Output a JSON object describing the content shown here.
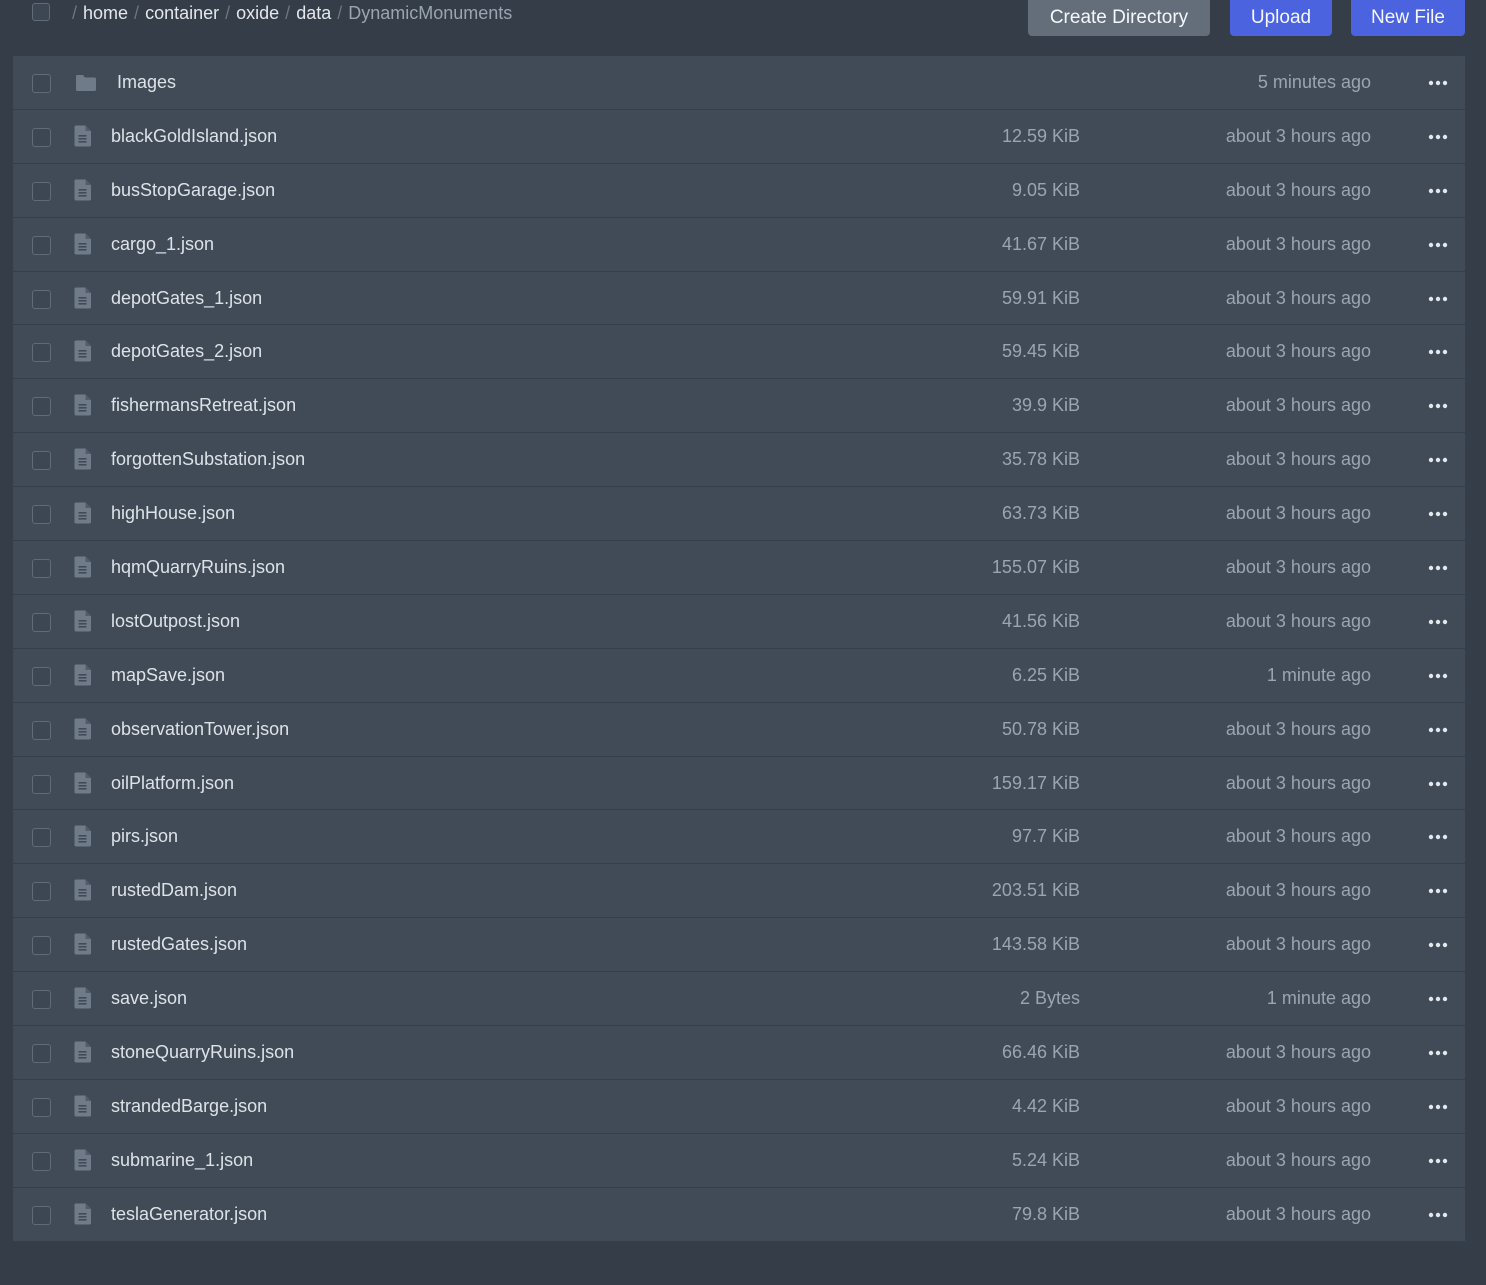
{
  "breadcrumb": {
    "separator": "/",
    "segments": [
      "home",
      "container",
      "oxide",
      "data",
      "DynamicMonuments"
    ]
  },
  "toolbar": {
    "create_directory_label": "Create Directory",
    "upload_label": "Upload",
    "new_file_label": "New File"
  },
  "colors": {
    "background": "#343d48",
    "row": "#414b57",
    "primary_button": "#4b63df",
    "secondary_button": "#646e7b"
  },
  "files": [
    {
      "name": "Images",
      "size": "",
      "modified": "5 minutes ago",
      "type": "directory",
      "icon": "folder-icon"
    },
    {
      "name": "blackGoldIsland.json",
      "size": "12.59 KiB",
      "modified": "about 3 hours ago",
      "type": "file",
      "icon": "file-icon"
    },
    {
      "name": "busStopGarage.json",
      "size": "9.05 KiB",
      "modified": "about 3 hours ago",
      "type": "file",
      "icon": "file-icon"
    },
    {
      "name": "cargo_1.json",
      "size": "41.67 KiB",
      "modified": "about 3 hours ago",
      "type": "file",
      "icon": "file-icon"
    },
    {
      "name": "depotGates_1.json",
      "size": "59.91 KiB",
      "modified": "about 3 hours ago",
      "type": "file",
      "icon": "file-icon"
    },
    {
      "name": "depotGates_2.json",
      "size": "59.45 KiB",
      "modified": "about 3 hours ago",
      "type": "file",
      "icon": "file-icon"
    },
    {
      "name": "fishermansRetreat.json",
      "size": "39.9 KiB",
      "modified": "about 3 hours ago",
      "type": "file",
      "icon": "file-icon"
    },
    {
      "name": "forgottenSubstation.json",
      "size": "35.78 KiB",
      "modified": "about 3 hours ago",
      "type": "file",
      "icon": "file-icon"
    },
    {
      "name": "highHouse.json",
      "size": "63.73 KiB",
      "modified": "about 3 hours ago",
      "type": "file",
      "icon": "file-icon"
    },
    {
      "name": "hqmQuarryRuins.json",
      "size": "155.07 KiB",
      "modified": "about 3 hours ago",
      "type": "file",
      "icon": "file-icon"
    },
    {
      "name": "lostOutpost.json",
      "size": "41.56 KiB",
      "modified": "about 3 hours ago",
      "type": "file",
      "icon": "file-icon"
    },
    {
      "name": "mapSave.json",
      "size": "6.25 KiB",
      "modified": "1 minute ago",
      "type": "file",
      "icon": "file-icon"
    },
    {
      "name": "observationTower.json",
      "size": "50.78 KiB",
      "modified": "about 3 hours ago",
      "type": "file",
      "icon": "file-icon"
    },
    {
      "name": "oilPlatform.json",
      "size": "159.17 KiB",
      "modified": "about 3 hours ago",
      "type": "file",
      "icon": "file-icon"
    },
    {
      "name": "pirs.json",
      "size": "97.7 KiB",
      "modified": "about 3 hours ago",
      "type": "file",
      "icon": "file-icon"
    },
    {
      "name": "rustedDam.json",
      "size": "203.51 KiB",
      "modified": "about 3 hours ago",
      "type": "file",
      "icon": "file-icon"
    },
    {
      "name": "rustedGates.json",
      "size": "143.58 KiB",
      "modified": "about 3 hours ago",
      "type": "file",
      "icon": "file-icon"
    },
    {
      "name": "save.json",
      "size": "2 Bytes",
      "modified": "1 minute ago",
      "type": "file",
      "icon": "file-icon"
    },
    {
      "name": "stoneQuarryRuins.json",
      "size": "66.46 KiB",
      "modified": "about 3 hours ago",
      "type": "file",
      "icon": "file-icon"
    },
    {
      "name": "strandedBarge.json",
      "size": "4.42 KiB",
      "modified": "about 3 hours ago",
      "type": "file",
      "icon": "file-icon"
    },
    {
      "name": "submarine_1.json",
      "size": "5.24 KiB",
      "modified": "about 3 hours ago",
      "type": "file",
      "icon": "file-icon"
    },
    {
      "name": "teslaGenerator.json",
      "size": "79.8 KiB",
      "modified": "about 3 hours ago",
      "type": "file",
      "icon": "file-icon"
    }
  ]
}
